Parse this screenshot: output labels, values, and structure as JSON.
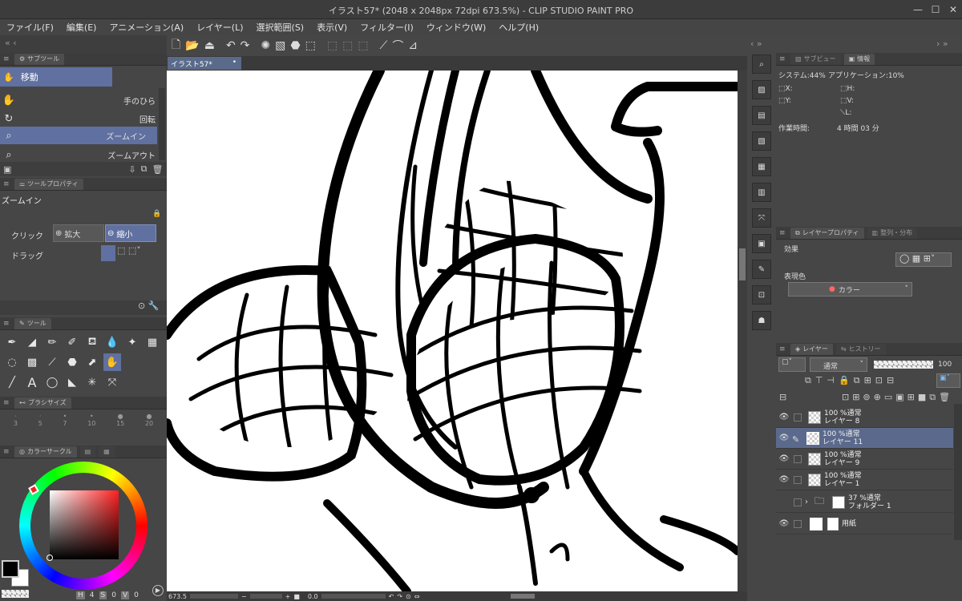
{
  "window": {
    "title": "イラスト57* (2048 x 2048px 72dpi 673.5%)  - CLIP STUDIO PAINT PRO",
    "min": "—",
    "max": "☐",
    "close": "✕"
  },
  "menu": [
    "ファイル(F)",
    "編集(E)",
    "アニメーション(A)",
    "レイヤー(L)",
    "選択範囲(S)",
    "表示(V)",
    "フィルター(I)",
    "ウィンドウ(W)",
    "ヘルプ(H)"
  ],
  "subtool": {
    "tab": "サブツール",
    "group": "移動",
    "items": [
      "手のひら",
      "回転",
      "ズームイン",
      "ズームアウト"
    ]
  },
  "toolprop": {
    "tab": "ツールプロパティ",
    "title": "ズームイン",
    "click_label": "クリック",
    "zoom_in": "拡大",
    "zoom_out": "縮小",
    "drag_label": "ドラッグ"
  },
  "tools_tab": "ツール",
  "brushsize": {
    "tab": "ブラシサイズ",
    "sizes": [
      "3",
      "5",
      "7",
      "10",
      "15",
      "20"
    ]
  },
  "colorwheel": {
    "tab": "カラーサークル",
    "main_color": "#000000",
    "sub_color": "#ffffff",
    "h": "4",
    "s": "0",
    "v": "0",
    "h_label": "H",
    "s_label": "S",
    "v_label": "V"
  },
  "canvas": {
    "tab": "イラスト57*",
    "zoom": "673.5",
    "angle": "0.0"
  },
  "info": {
    "tab1": "サブビュー",
    "tab2": "情報",
    "system": "システム:44%",
    "app": "アプリケーション:10%",
    "x": "X:",
    "y": "Y:",
    "h": "H:",
    "v": "V:",
    "l": "L:",
    "worktime_label": "作業時間:",
    "worktime": "4 時間 03 分"
  },
  "layerprop": {
    "tab1": "レイヤープロパティ",
    "tab2": "整列・分布",
    "effect": "効果",
    "express": "表現色",
    "color_mode": "カラー"
  },
  "layers": {
    "tab1": "レイヤー",
    "tab2": "ヒストリー",
    "blend": "通常",
    "opacity": "100",
    "items": [
      {
        "pct": "100 %通常",
        "name": "レイヤー 8"
      },
      {
        "pct": "100 %通常",
        "name": "レイヤー 11"
      },
      {
        "pct": "100 %通常",
        "name": "レイヤー 9"
      },
      {
        "pct": "100 %通常",
        "name": "レイヤー 1"
      },
      {
        "pct": "37 %通常",
        "name": "フォルダー 1"
      },
      {
        "pct": "",
        "name": "用紙"
      }
    ]
  },
  "colors": {
    "accent": "#6070a0",
    "selected_layer": "#5b6a8c",
    "panel": "#464646"
  }
}
